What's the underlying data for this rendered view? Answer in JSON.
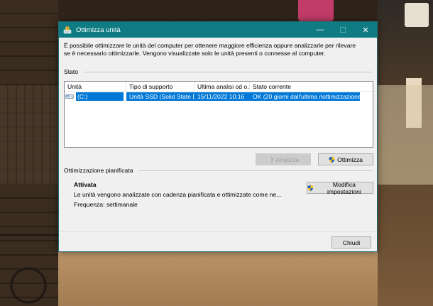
{
  "window": {
    "title": "Ottimizza unità",
    "controls": {
      "minimize": "—",
      "maximize": "☐",
      "close": "✕"
    }
  },
  "description": "È possibile ottimizzare le unità del computer per ottenere maggiore efficienza oppure analizzarle per rilevare se è necessario ottimizzarle. Vengono visualizzate solo le unità presenti o connesse al computer.",
  "status_section": {
    "label": "Stato",
    "columns": [
      "Unità",
      "Tipo di supporto",
      "Ultima analisi od o...",
      "Stato corrente"
    ],
    "rows": [
      {
        "drive": "(C:)",
        "media_type": "Unità SSD (Solid State D...",
        "last_run": "15/11/2022 10:16",
        "status": "OK (20 giorni dall'ultima riottimizzazione)",
        "selected": true
      }
    ]
  },
  "buttons": {
    "analyze": "Analizza",
    "optimize": "Ottimizza",
    "change_settings": "Modifica impostazioni",
    "close": "Chiudi"
  },
  "scheduled": {
    "label": "Ottimizzazione pianificata",
    "state": "Attivata",
    "detail": "Le unità vengono analizzate con cadenza pianificata e ottimizzate come ne...",
    "frequency": "Frequenza: settimanale"
  },
  "colors": {
    "titlebar": "#0f7b83",
    "selection": "#0078d7",
    "dialog_bg": "#f0f0f0"
  },
  "icons": {
    "app": "defrag-app-icon",
    "drive": "hard-drive-icon",
    "uac": "uac-shield-icon"
  }
}
